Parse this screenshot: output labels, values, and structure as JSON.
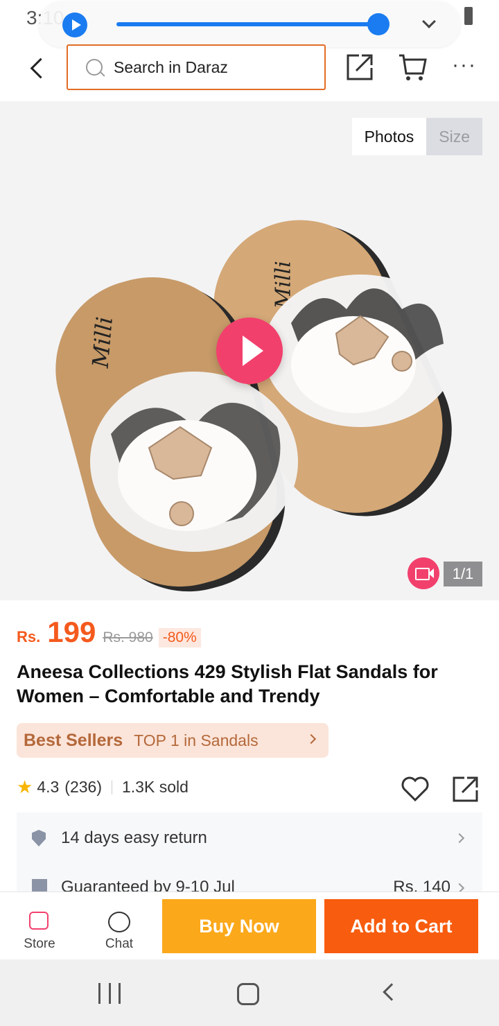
{
  "status_bar": {
    "time": "3:10",
    "media_progress_percent": 100,
    "icons": [
      "play-icon",
      "chevron-down-icon",
      "wifi-icon",
      "signal-icon",
      "battery-icon"
    ]
  },
  "header": {
    "search_placeholder": "Search in Daraz",
    "accent_color": "#e26c25",
    "icons": [
      "back-icon",
      "search-icon",
      "share-icon",
      "cart-icon",
      "more-icon"
    ]
  },
  "gallery": {
    "tabs": [
      {
        "label": "Photos",
        "selected": true
      },
      {
        "label": "Size",
        "selected": false
      }
    ],
    "counter": "1/1",
    "image_logo": "Milli",
    "icons": [
      "play-icon",
      "video-icon"
    ]
  },
  "product": {
    "currency": "Rs.",
    "price": "199",
    "old_price": "Rs. 980",
    "discount": "-80%",
    "price_color": "#f45a1d",
    "title": "Aneesa Collections 429 Stylish Flat Sandals for Women – Comfortable and Trendy",
    "best_seller": {
      "badge": "Best Sellers",
      "text": "TOP 1 in Sandals"
    },
    "rating": "4.3",
    "reviews": "(236)",
    "sold": "1.3K sold",
    "rating_stars": 4.3
  },
  "services": {
    "return_text": "14 days easy return",
    "guarantee_text": "Guaranteed by 9-10 Jul",
    "guarantee_fee": "Rs. 140"
  },
  "action_bar": {
    "store_label": "Store",
    "chat_label": "Chat",
    "buy_now_label": "Buy Now",
    "add_to_cart_label": "Add to Cart",
    "buy_now_color": "#fba81a",
    "add_to_cart_color": "#f85c0e"
  },
  "nav_bar": {
    "icons": [
      "recents-icon",
      "home-icon",
      "back-icon"
    ]
  }
}
